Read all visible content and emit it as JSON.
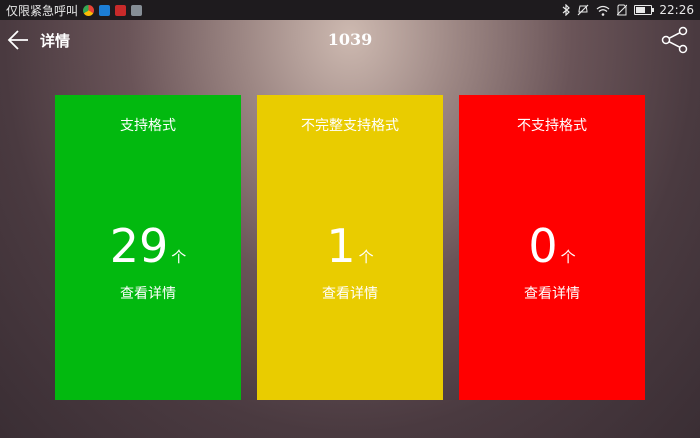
{
  "status_bar": {
    "carrier_text": "仅限紧急呼叫",
    "time": "22:26",
    "app_icons": [
      "chrome-icon",
      "edit-app-icon",
      "mail-app-icon",
      "image-app-icon"
    ],
    "status_icons": [
      "bluetooth-icon",
      "mute-icon",
      "wifi-icon",
      "no-sim-icon",
      "battery-icon"
    ],
    "battery_level": 0.6
  },
  "toolbar": {
    "back_icon": "arrow-left-icon",
    "title": "详情",
    "center_title": "1039",
    "share_icon": "share-icon"
  },
  "cards": [
    {
      "title": "支持格式",
      "count": "29",
      "unit": "个",
      "link": "查看详情",
      "color": "#02b90f"
    },
    {
      "title": "不完整支持格式",
      "count": "1",
      "unit": "个",
      "link": "查看详情",
      "color": "#e9cc00"
    },
    {
      "title": "不支持格式",
      "count": "0",
      "unit": "个",
      "link": "查看详情",
      "color": "#ff0000"
    }
  ]
}
